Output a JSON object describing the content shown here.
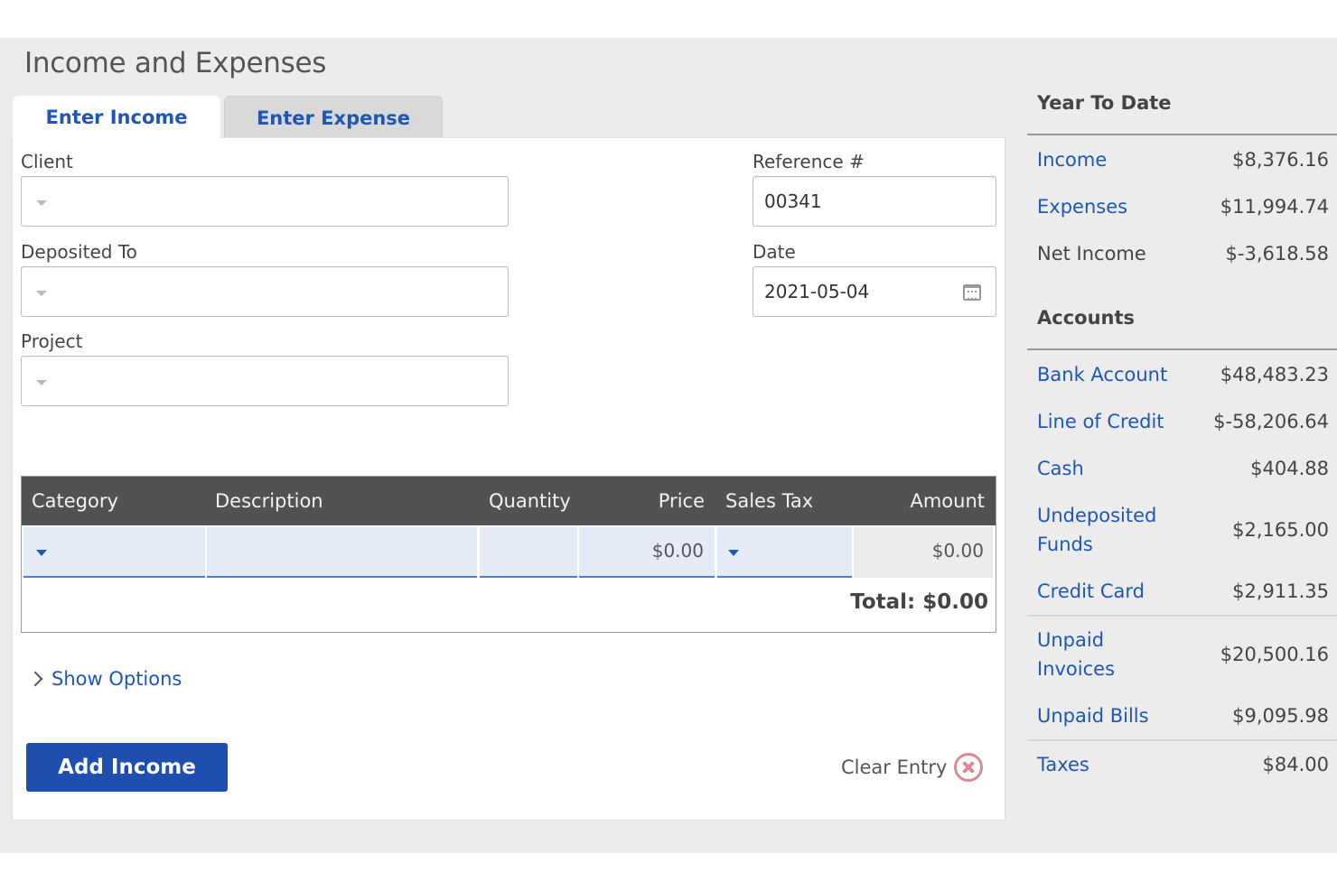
{
  "page": {
    "title": "Income and Expenses"
  },
  "tabs": {
    "income": "Enter Income",
    "expense": "Enter Expense"
  },
  "form": {
    "client_label": "Client",
    "deposited_label": "Deposited To",
    "project_label": "Project",
    "reference_label": "Reference #",
    "reference_value": "00341",
    "date_label": "Date",
    "date_value": "2021-05-04"
  },
  "table": {
    "headers": {
      "category": "Category",
      "description": "Description",
      "quantity": "Quantity",
      "price": "Price",
      "sales_tax": "Sales Tax",
      "amount": "Amount"
    },
    "row": {
      "category": "",
      "description": "",
      "quantity": "",
      "price": "$0.00",
      "sales_tax": "",
      "amount": "$0.00"
    },
    "total": "Total: $0.00"
  },
  "show_options": "Show Options",
  "buttons": {
    "add_income": "Add Income",
    "clear_entry": "Clear Entry"
  },
  "sidebar": {
    "ytd_heading": "Year To Date",
    "ytd": [
      {
        "label": "Income",
        "value": "$8,376.16",
        "link": true
      },
      {
        "label": "Expenses",
        "value": "$11,994.74",
        "link": true
      },
      {
        "label": "Net Income",
        "value": "$-3,618.58",
        "link": false
      }
    ],
    "accounts_heading": "Accounts",
    "accounts": [
      {
        "label": "Bank Account",
        "value": "$48,483.23"
      },
      {
        "label": "Line of Credit",
        "value": "$-58,206.64"
      },
      {
        "label": "Cash",
        "value": "$404.88"
      },
      {
        "label": "Undeposited Funds",
        "value": "$2,165.00"
      },
      {
        "label": "Credit Card",
        "value": "$2,911.35"
      },
      {
        "label": "Unpaid Invoices",
        "value": "$20,500.16"
      },
      {
        "label": "Unpaid Bills",
        "value": "$9,095.98"
      },
      {
        "label": "Taxes",
        "value": "$84.00"
      }
    ]
  },
  "colors": {
    "accent": "#1e57b5",
    "button": "#1e4fb0",
    "table_header": "#525252",
    "clear_icon": "#d98a96"
  }
}
